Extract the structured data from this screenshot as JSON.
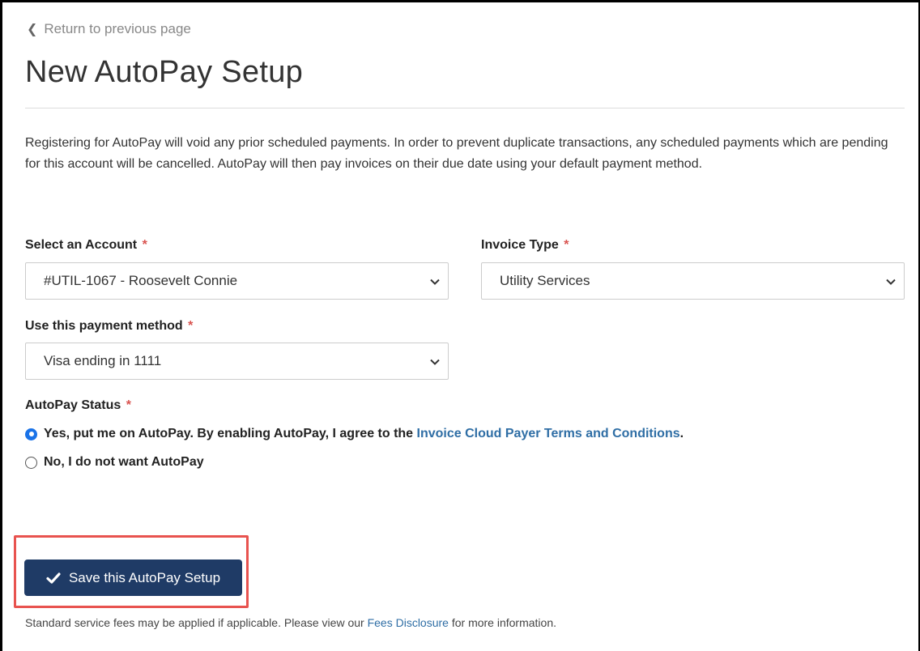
{
  "nav": {
    "back_label": "Return to previous page"
  },
  "page": {
    "title": "New AutoPay Setup"
  },
  "intro_text": "Registering for AutoPay will void any prior scheduled payments. In order to prevent duplicate transactions, any scheduled payments which are pending for this account will be cancelled. AutoPay will then pay invoices on their due date using your default payment method.",
  "form": {
    "account": {
      "label": "Select an Account",
      "required": "*",
      "value": "#UTIL-1067 - Roosevelt Connie"
    },
    "invoice_type": {
      "label": "Invoice Type",
      "required": "*",
      "value": "Utility Services"
    },
    "payment_method": {
      "label": "Use this payment method",
      "required": "*",
      "value": "Visa ending in 1111"
    },
    "autopay_status": {
      "label": "AutoPay Status",
      "required": "*",
      "options": [
        {
          "text": "Yes, put me on AutoPay. By enabling AutoPay, I agree to the ",
          "link_text": "Invoice Cloud Payer Terms and Conditions",
          "suffix": ".",
          "checked": true
        },
        {
          "text": "No, I do not want AutoPay",
          "checked": false
        }
      ]
    }
  },
  "save_button": {
    "label": "Save this AutoPay Setup",
    "icon": "checkmark-icon"
  },
  "footnote": {
    "before": "Standard service fees may be applied if applicable. Please view our ",
    "link_text": "Fees Disclosure",
    "after": " for more information."
  },
  "colors": {
    "primary_button": "#1f3b66",
    "link": "#2f6ea5",
    "required": "#d9534f",
    "highlight": "#e8534f",
    "radio_checked": "#1a73e8"
  }
}
